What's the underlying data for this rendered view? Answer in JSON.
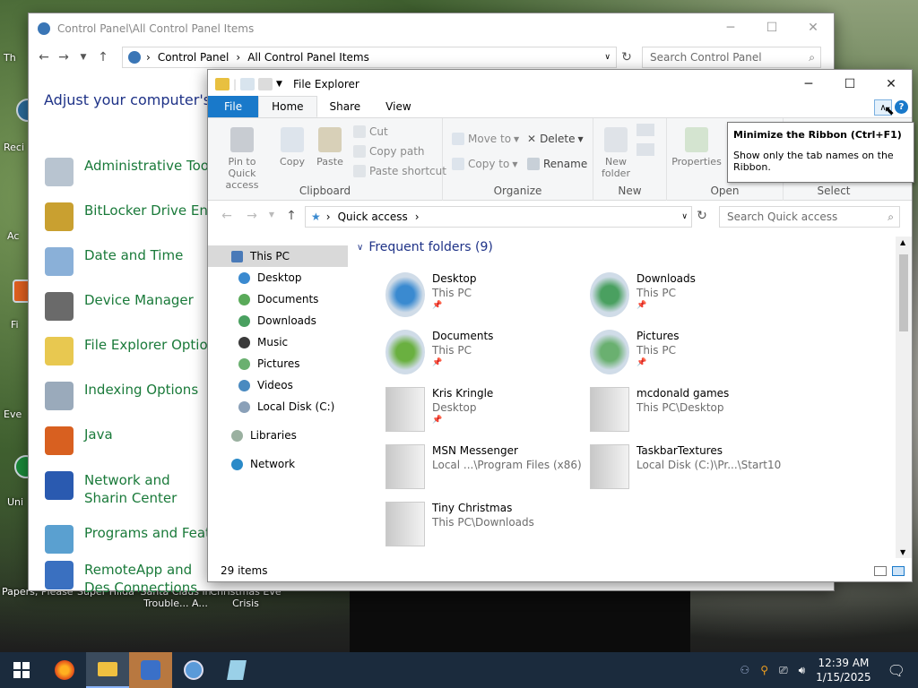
{
  "desktop": {
    "labels": [
      "Th",
      "Reci",
      "Ac",
      "Fi",
      "Eve",
      "Uni",
      "Papers, Please",
      "Super Hiida",
      "Santa Claus in Trouble... A...",
      "Christmas Eve Crisis"
    ]
  },
  "control_panel": {
    "title": "Control Panel\\All Control Panel Items",
    "breadcrumb": [
      "Control Panel",
      "All Control Panel Items"
    ],
    "search_placeholder": "Search Control Panel",
    "heading": "Adjust your computer's se",
    "items": [
      "Administrative Tools",
      "BitLocker Drive Encr",
      "Date and Time",
      "Device Manager",
      "File Explorer Option",
      "Indexing Options",
      "Java",
      "Network and Sharin Center",
      "Programs and Featu",
      "RemoteApp and Des Connections"
    ]
  },
  "explorer": {
    "title": "File Explorer",
    "tabs": {
      "file": "File",
      "home": "Home",
      "share": "Share",
      "view": "View"
    },
    "ribbon": {
      "pin": "Pin to Quick access",
      "copy": "Copy",
      "paste": "Paste",
      "cut": "Cut",
      "copy_path": "Copy path",
      "paste_shortcut": "Paste shortcut",
      "clipboard": "Clipboard",
      "move_to": "Move to",
      "copy_to": "Copy to",
      "delete": "Delete",
      "rename": "Rename",
      "organize": "Organize",
      "new_folder": "New folder",
      "new": "New",
      "properties": "Properties",
      "open": "Open",
      "select": "Select"
    },
    "tooltip": {
      "title": "Minimize the Ribbon (Ctrl+F1)",
      "desc": "Show only the tab names on the Ribbon."
    },
    "address": {
      "location": "Quick access",
      "search_placeholder": "Search Quick access"
    },
    "nav": [
      "This PC",
      "Desktop",
      "Documents",
      "Downloads",
      "Music",
      "Pictures",
      "Videos",
      "Local Disk (C:)",
      "Libraries",
      "Network"
    ],
    "group_label": "Frequent folders (9)",
    "folders": [
      {
        "name": "Desktop",
        "sub": "This PC"
      },
      {
        "name": "Downloads",
        "sub": "This PC"
      },
      {
        "name": "Documents",
        "sub": "This PC"
      },
      {
        "name": "Pictures",
        "sub": "This PC"
      },
      {
        "name": "Kris Kringle",
        "sub": "Desktop"
      },
      {
        "name": "mcdonald games",
        "sub": "This PC\\Desktop"
      },
      {
        "name": "MSN Messenger",
        "sub": "Local ...\\Program Files (x86)"
      },
      {
        "name": "TaskbarTextures",
        "sub": "Local Disk (C:)\\Pr...\\Start10"
      },
      {
        "name": "Tiny Christmas",
        "sub": "This PC\\Downloads"
      }
    ],
    "status": "29 items"
  },
  "taskbar": {
    "time": "12:39 AM",
    "date": "1/15/2025"
  },
  "colors": {
    "accent": "#1979ca",
    "link_green": "#1a7a3a",
    "heading_blue": "#1e3287",
    "taskbar": "#1b2b3d"
  }
}
